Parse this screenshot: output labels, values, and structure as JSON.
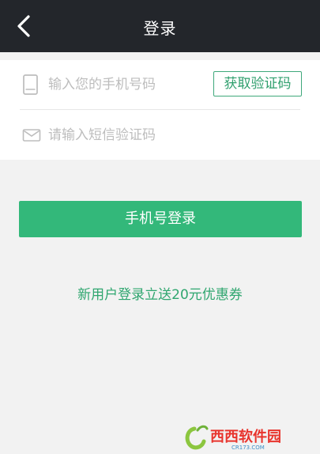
{
  "header": {
    "title": "登录"
  },
  "form": {
    "phone_placeholder": "输入您的手机号码",
    "get_code_label": "获取验证码",
    "code_placeholder": "请输入短信验证码"
  },
  "actions": {
    "login_label": "手机号登录"
  },
  "promo": {
    "text": "新用户登录立送20元优惠券"
  },
  "watermark": {
    "site_name": "西西软件园",
    "site_url": "CR173.COM"
  },
  "colors": {
    "header_bg": "#23262b",
    "accent_green": "#33b87a",
    "page_bg": "#f2f2f2"
  },
  "icons": {
    "back": "chevron-left-icon",
    "phone": "phone-icon",
    "mail": "mail-icon"
  }
}
